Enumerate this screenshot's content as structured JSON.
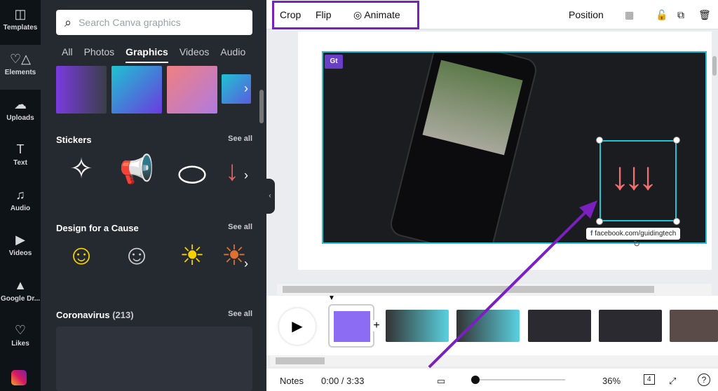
{
  "rail": [
    {
      "label": "Templates",
      "icon": "layout-icon"
    },
    {
      "label": "Elements",
      "icon": "shapes-icon"
    },
    {
      "label": "Uploads",
      "icon": "cloud-upload-icon"
    },
    {
      "label": "Text",
      "icon": "text-icon"
    },
    {
      "label": "Audio",
      "icon": "music-icon"
    },
    {
      "label": "Videos",
      "icon": "video-icon"
    },
    {
      "label": "Google Dr...",
      "icon": "google-drive-icon"
    },
    {
      "label": "Likes",
      "icon": "heart-icon"
    }
  ],
  "panel": {
    "search_placeholder": "Search Canva graphics",
    "tabs": [
      "All",
      "Photos",
      "Graphics",
      "Videos",
      "Audio"
    ],
    "sections": [
      {
        "title": "Stickers",
        "see_all": "See all"
      },
      {
        "title": "Design for a Cause",
        "see_all": "See all"
      },
      {
        "title": "Coronavirus",
        "count": "(213)",
        "see_all": "See all"
      }
    ]
  },
  "toolbar": {
    "crop": "Crop",
    "flip": "Flip",
    "animate": "Animate",
    "position": "Position"
  },
  "canvas": {
    "logo": "Gt",
    "watermark": "facebook.com/guidingtech"
  },
  "footer": {
    "notes": "Notes",
    "time": "0:00 / 3:33",
    "zoom": "36%",
    "pages": "4",
    "help": "?"
  },
  "colors": {
    "accent": "#22c3d3",
    "highlight": "#7a1fc0"
  }
}
